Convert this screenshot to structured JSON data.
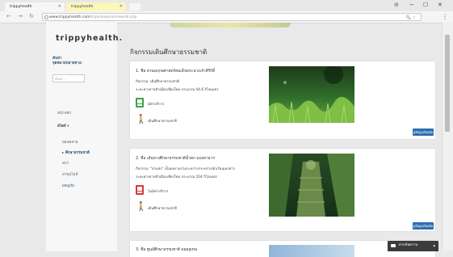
{
  "browser": {
    "tabs": [
      {
        "label": "trippyhealth"
      },
      {
        "label": "trippyhealth"
      }
    ],
    "url_domain": "www.trippyhealth.com",
    "url_path": "/tripsdeepnaturewalk.php",
    "window_controls": {
      "account": "⊝",
      "minimize": "−",
      "maximize": "☐",
      "close": "✕"
    }
  },
  "sidebar": {
    "logo": "trippyhealth.",
    "search_label_1": "ค้นหา",
    "search_label_2": "จุดหมายปลายทาง:",
    "search_placeholder": "ค้นหา...",
    "nav_home": "หน้าหลัก",
    "nav_style": "สไตล์ ▾",
    "sub_items": [
      {
        "label": "ผ่อนคลาย"
      },
      {
        "label": "▸  ศึกษาธรรมชาติ"
      },
      {
        "label": "สปา"
      },
      {
        "label": "ล่าขุมไลฟ์"
      },
      {
        "label": "ผจญภัย"
      }
    ]
  },
  "main": {
    "heading": "กิจกรรมเดินศึกษาธรรมชาติ",
    "cards": [
      {
        "title": "1. ชื่อ สวนพฤกษศาสตร์สมเด็จพระนางเจ้าสิริกิติ์",
        "activity": "กิจกรรม: เดินศึกษาธรรมชาติ",
        "distance": "ระยะทางจากตัวเมืองเชียงใหม่ ประมาณ 44.6 กิโลเมตร",
        "fee": "มีค่าบริการ",
        "walk": "เดินศึกษาธรรมชาติ",
        "more": "ดูข้อมูลเพิ่มเติม"
      },
      {
        "title": "2. ชื่อ เส้นทางศึกษาธรรมชาติน้ำตก มณฑาธาร",
        "activity": "กิจกรรม: \"ล่าแสง\" เป็นผลงานร่วมระหว่างกระทรวงนักเรียนเอกสาร",
        "distance": "ระยะทางจากตัวเมืองเชียงใหม่ ประมาณ 104 กิโลเมตร",
        "fee": "ไม่มีค่าบริการ",
        "walk": "เดินศึกษาธรรมชาติ",
        "more": "ดูข้อมูลเพิ่มเติม"
      },
      {
        "title": "3. ชื่อ ศูนย์ศึกษาธรรมชาติ ดอยสุเทพ"
      }
    ]
  },
  "chat": {
    "label": "ฝากข้อความ"
  },
  "colors": {
    "accent": "#2d6fb1",
    "link": "#2a5276",
    "fee_paid": "#3aa34a",
    "fee_free": "#d33a3a"
  }
}
